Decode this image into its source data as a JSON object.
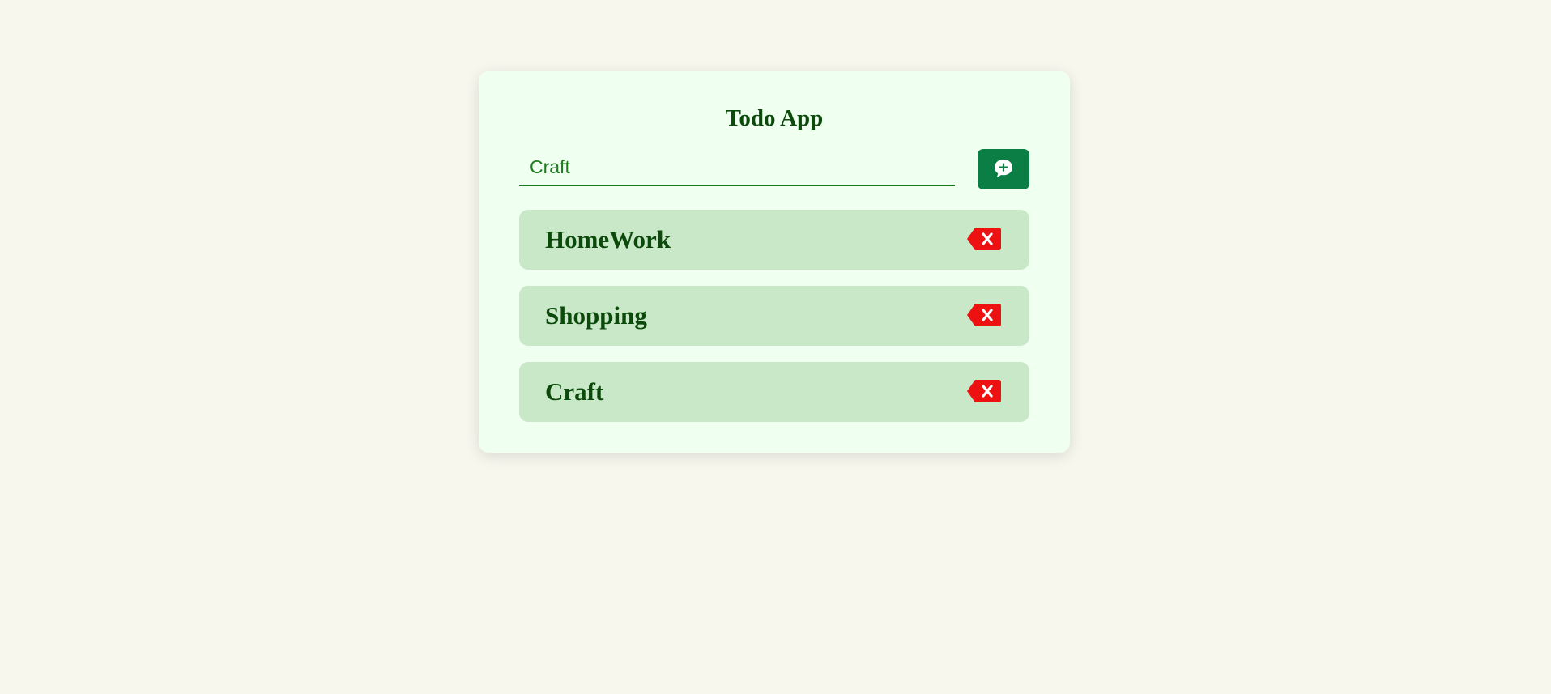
{
  "app": {
    "title": "Todo App"
  },
  "input": {
    "value": "Craft",
    "placeholder": ""
  },
  "add_button": {
    "icon": "comment-plus-icon",
    "color": "#0a7e45"
  },
  "todos": [
    {
      "label": "HomeWork",
      "delete_icon": "backspace-icon"
    },
    {
      "label": "Shopping",
      "delete_icon": "backspace-icon"
    },
    {
      "label": "Craft",
      "delete_icon": "backspace-icon"
    }
  ],
  "colors": {
    "page_background": "#f7f7ee",
    "card_background": "#effff0",
    "item_background": "#c8e8c8",
    "text": "#0b4a0b",
    "delete": "#ee1111"
  }
}
